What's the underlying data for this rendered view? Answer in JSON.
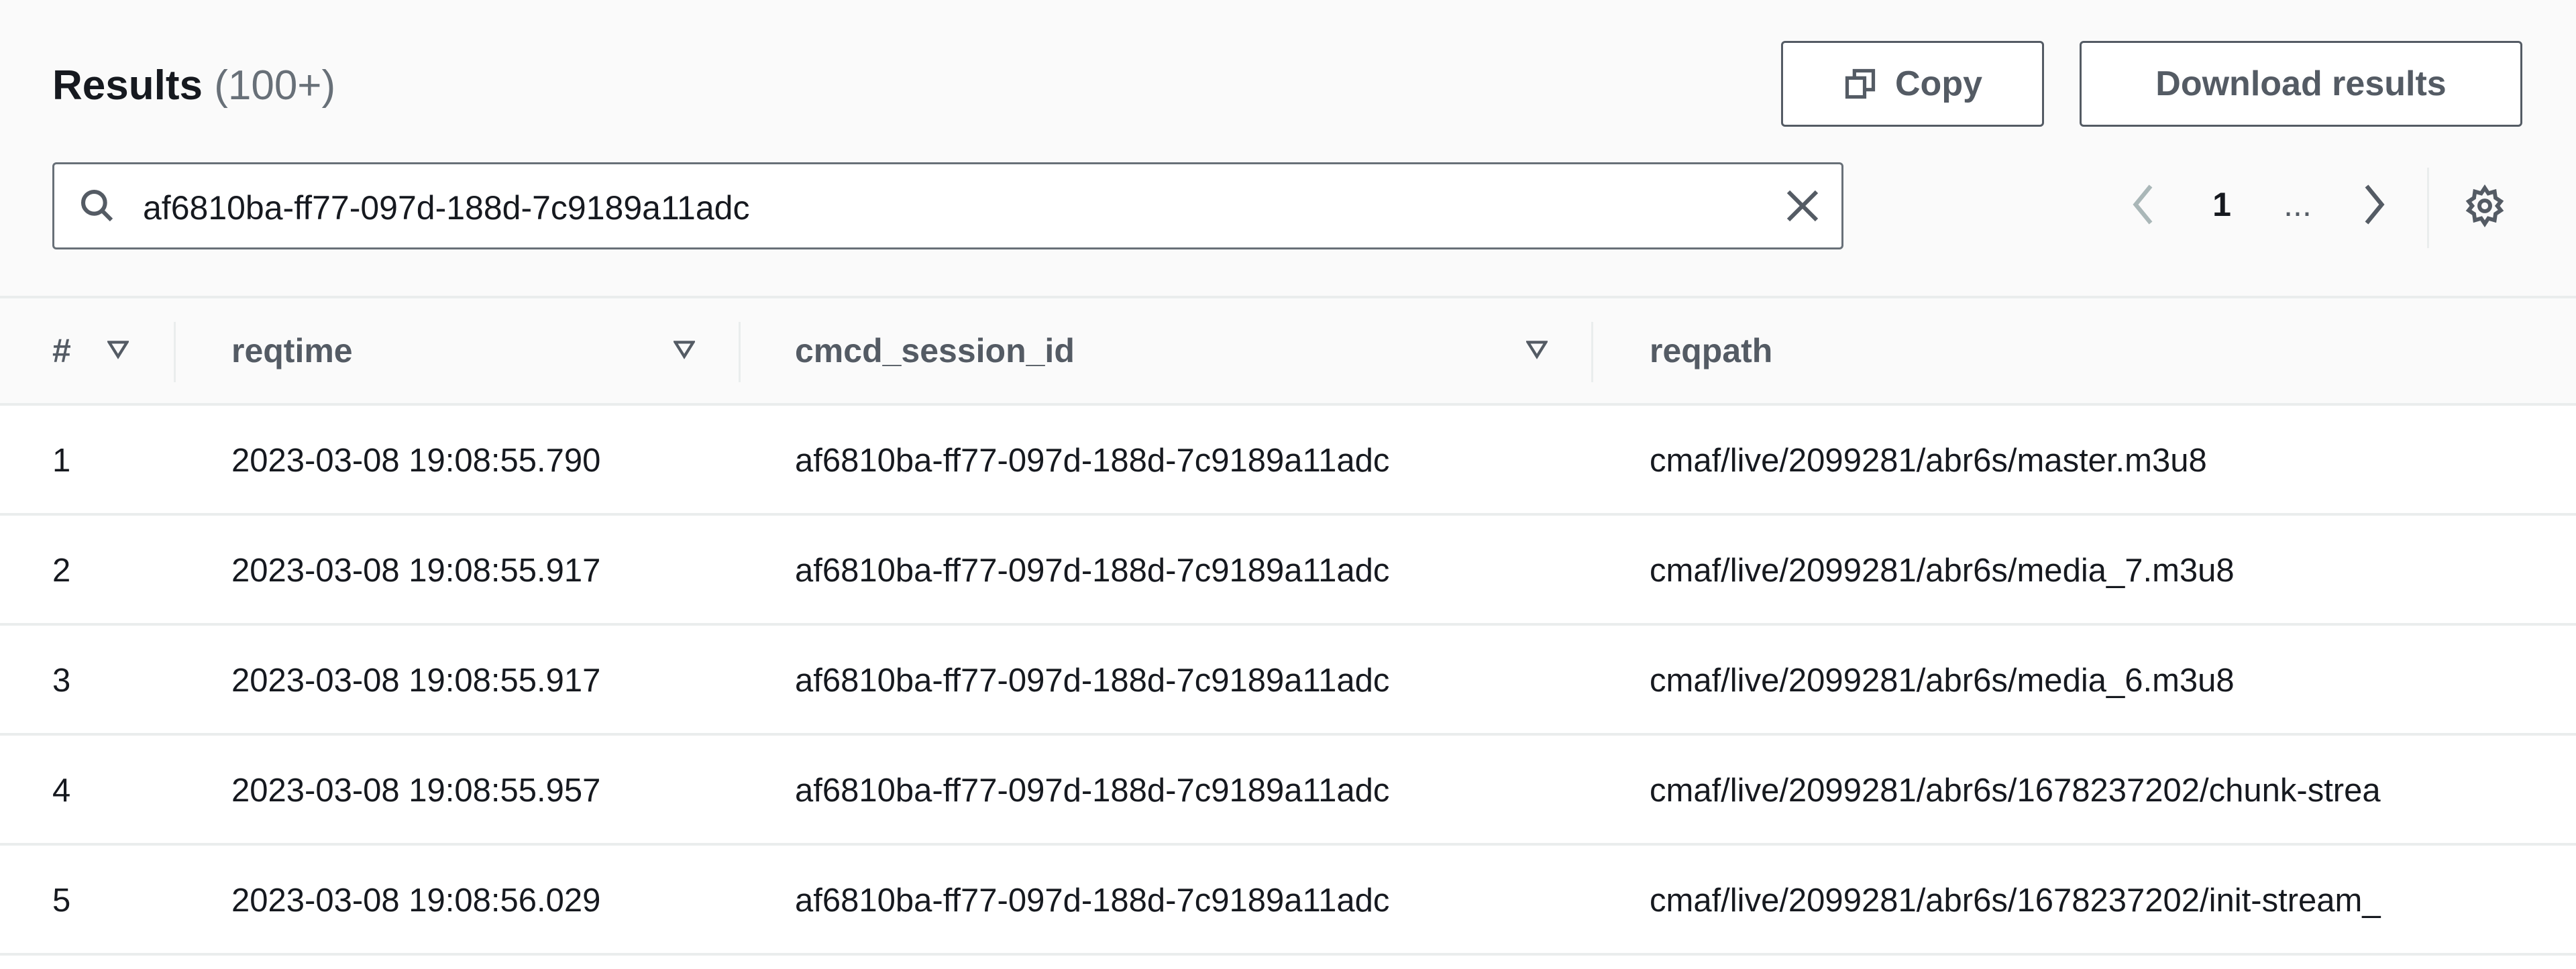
{
  "header": {
    "title": "Results",
    "count": "(100+)"
  },
  "toolbar": {
    "copy_label": "Copy",
    "download_label": "Download results"
  },
  "search": {
    "value": "af6810ba-ff77-097d-188d-7c9189a11adc"
  },
  "pagination": {
    "current_page": "1",
    "ellipsis": "..."
  },
  "table": {
    "columns": [
      "#",
      "reqtime",
      "cmcd_session_id",
      "reqpath"
    ],
    "rows": [
      {
        "n": "1",
        "reqtime": "2023-03-08 19:08:55.790",
        "session": "af6810ba-ff77-097d-188d-7c9189a11adc",
        "reqpath": "cmaf/live/2099281/abr6s/master.m3u8"
      },
      {
        "n": "2",
        "reqtime": "2023-03-08 19:08:55.917",
        "session": "af6810ba-ff77-097d-188d-7c9189a11adc",
        "reqpath": "cmaf/live/2099281/abr6s/media_7.m3u8"
      },
      {
        "n": "3",
        "reqtime": "2023-03-08 19:08:55.917",
        "session": "af6810ba-ff77-097d-188d-7c9189a11adc",
        "reqpath": "cmaf/live/2099281/abr6s/media_6.m3u8"
      },
      {
        "n": "4",
        "reqtime": "2023-03-08 19:08:55.957",
        "session": "af6810ba-ff77-097d-188d-7c9189a11adc",
        "reqpath": "cmaf/live/2099281/abr6s/1678237202/chunk-strea"
      },
      {
        "n": "5",
        "reqtime": "2023-03-08 19:08:56.029",
        "session": "af6810ba-ff77-097d-188d-7c9189a11adc",
        "reqpath": "cmaf/live/2099281/abr6s/1678237202/init-stream_"
      }
    ]
  }
}
